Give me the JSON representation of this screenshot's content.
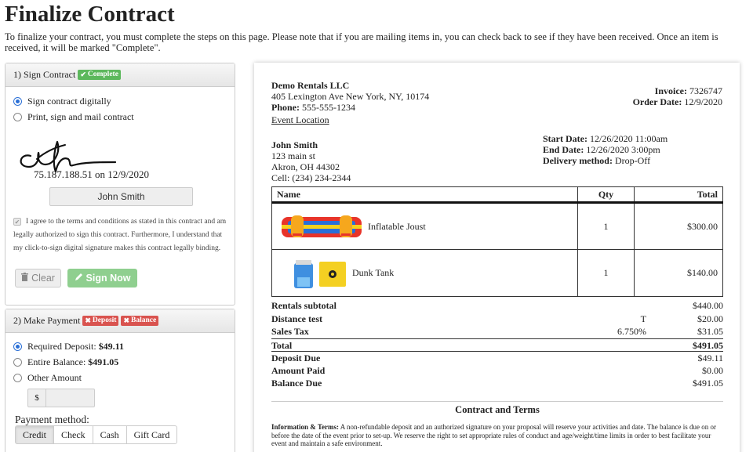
{
  "page": {
    "title": "Finalize Contract",
    "intro": "To finalize your contract, you must complete the steps on this page. Please note that if you are mailing items in, you can check back to see if they have been received. Once an item is received, it will be marked \"Complete\"."
  },
  "sign_panel": {
    "header": "1) Sign Contract",
    "badge": "Complete",
    "options": [
      "Sign contract digitally",
      "Print, sign and mail contract"
    ],
    "selected_option": "Sign contract digitally",
    "signature_meta": "75.187.188.51 on 12/9/2020",
    "signer_name": "John Smith",
    "terms_text": "I agree to the terms and conditions as stated in this contract and am legally authorized to sign this contract. Furthermore, I understand that my click-to-sign digital signature makes this contract legally binding.",
    "clear_label": "Clear",
    "sign_label": "Sign Now"
  },
  "pay_panel": {
    "header": "2) Make Payment",
    "badges": [
      "Deposit",
      "Balance"
    ],
    "deposit_label": "Required Deposit:",
    "deposit_value": "$49.11",
    "balance_label": "Entire Balance:",
    "balance_value": "$491.05",
    "other_label": "Other Amount",
    "currency_symbol": "$",
    "method_label": "Payment method:",
    "methods": [
      "Credit",
      "Check",
      "Cash",
      "Gift Card"
    ],
    "selected_method": "Credit"
  },
  "invoice": {
    "company_name": "Demo Rentals LLC",
    "company_address": "405 Lexington Ave New York, NY, 10174",
    "phone_label": "Phone:",
    "phone": "555-555-1234",
    "event_location_link": "Event Location",
    "invoice_label": "Invoice:",
    "invoice_number": "7326747",
    "order_date_label": "Order Date:",
    "order_date": "12/9/2020",
    "customer_name": "John Smith",
    "customer_street": "123 main st",
    "customer_city": "Akron, OH 44302",
    "customer_cell": "Cell: (234) 234-2344",
    "start_label": "Start Date:",
    "start_value": "12/26/2020 11:00am",
    "end_label": "End Date:",
    "end_value": "12/26/2020 3:00pm",
    "delivery_label": "Delivery method:",
    "delivery_value": "Drop-Off",
    "columns": [
      "Name",
      "Qty",
      "Total"
    ],
    "items": [
      {
        "name": "Inflatable Joust",
        "qty": "1",
        "total": "$300.00"
      },
      {
        "name": "Dunk Tank",
        "qty": "1",
        "total": "$140.00"
      }
    ],
    "totals": [
      {
        "label": "Rentals subtotal",
        "mid": "",
        "value": "$440.00"
      },
      {
        "label": "Distance test",
        "mid": "T",
        "value": "$20.00"
      },
      {
        "label": "Sales Tax",
        "mid": "6.750%",
        "value": "$31.05"
      },
      {
        "label": "Total",
        "mid": "",
        "value": "$491.05"
      },
      {
        "label": "Deposit Due",
        "mid": "",
        "value": "$49.11"
      },
      {
        "label": "Amount Paid",
        "mid": "",
        "value": "$0.00"
      },
      {
        "label": "Balance Due",
        "mid": "",
        "value": "$491.05"
      }
    ],
    "contract_title": "Contract and Terms",
    "terms_heading": "Information & Terms:",
    "terms_body": "A non-refundable deposit and an authorized signature on your proposal will reserve your activities and date. The balance is due on or before the date of the event prior to set-up. We reserve the right to set appropriate rules of conduct and age/weight/time limits in order to best facilitate your event and maintain a safe environment."
  },
  "colors": {
    "complete_badge": "#5cb85c",
    "due_badge": "#d9534f",
    "sign_button": "#8fcf8f",
    "radio_accent": "#2a6fd6"
  }
}
